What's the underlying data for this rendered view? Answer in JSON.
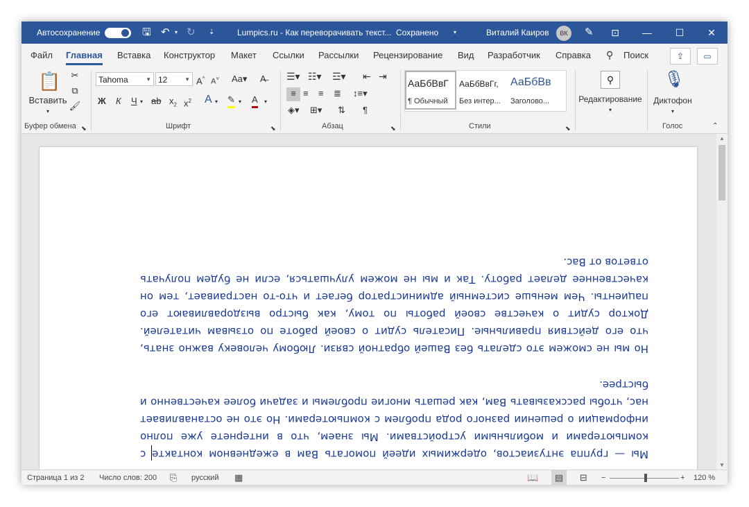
{
  "titlebar": {
    "autosave_label": "Автосохранение",
    "autosave_state": "on",
    "document_title": "Lumpics.ru - Как переворачивать текст...",
    "save_status": "Сохранено",
    "user_name": "Виталий Каиров",
    "user_initials": "ВК",
    "accent_color": "#2b579a"
  },
  "tabs": [
    "Файл",
    "Главная",
    "Вставка",
    "Конструктор",
    "Макет",
    "Ссылки",
    "Рассылки",
    "Рецензирование",
    "Вид",
    "Разработчик",
    "Справка"
  ],
  "active_tab": "Главная",
  "search_label": "Поиск",
  "ribbon": {
    "clipboard": {
      "paste_label": "Вставить",
      "group_label": "Буфер обмена"
    },
    "font": {
      "font_name": "Tahoma",
      "font_size": "12",
      "group_label": "Шрифт",
      "bold": "Ж",
      "italic": "К",
      "underline": "Ч"
    },
    "paragraph": {
      "group_label": "Абзац"
    },
    "styles": {
      "group_label": "Стили",
      "items": [
        {
          "sample": "АаБбВвГ",
          "name": "¶ Обычный"
        },
        {
          "sample": "АаБбВвГг,",
          "name": "Без интер..."
        },
        {
          "sample": "АаБбВв",
          "name": "Заголово..."
        }
      ]
    },
    "editing": {
      "label": "Редактирование"
    },
    "voice": {
      "dictate_label": "Диктофон",
      "group_label": "Голос"
    }
  },
  "document": {
    "paragraphs": [
      "Мы — группа энтузиастов, одержимых идеей помогать Вам в ежедневном контакте с компьютерами и мобильными устройствами. Мы знаем, что в интернете уже полно информации о решении разного рода проблем с компьютерами. Но это не останавливает нас, чтобы рассказывать Вам, как решать многие проблемы и задачи более качественно и быстрее.",
      "Но мы не сможем это сделать без Вашей обратной связи. Любому человеку важно знать, что его действия правильные. Писатель судит о своей работе по отзывам читателей. Доктор судит о качестве своей работы по тому, как быстро выздоравливают его пациенты. Чем меньше системный администратор бегает и что-то настраивает, тем он качественнее делает работу. Так и мы не можем улучшаться, если не будем получать ответов от Вас."
    ],
    "text_rotation_degrees": 180,
    "text_color": "#1a3b95"
  },
  "statusbar": {
    "page": "Страница 1 из 2",
    "word_count": "Число слов: 200",
    "language": "русский",
    "zoom": "120 %",
    "zoom_level_percent": 120
  }
}
